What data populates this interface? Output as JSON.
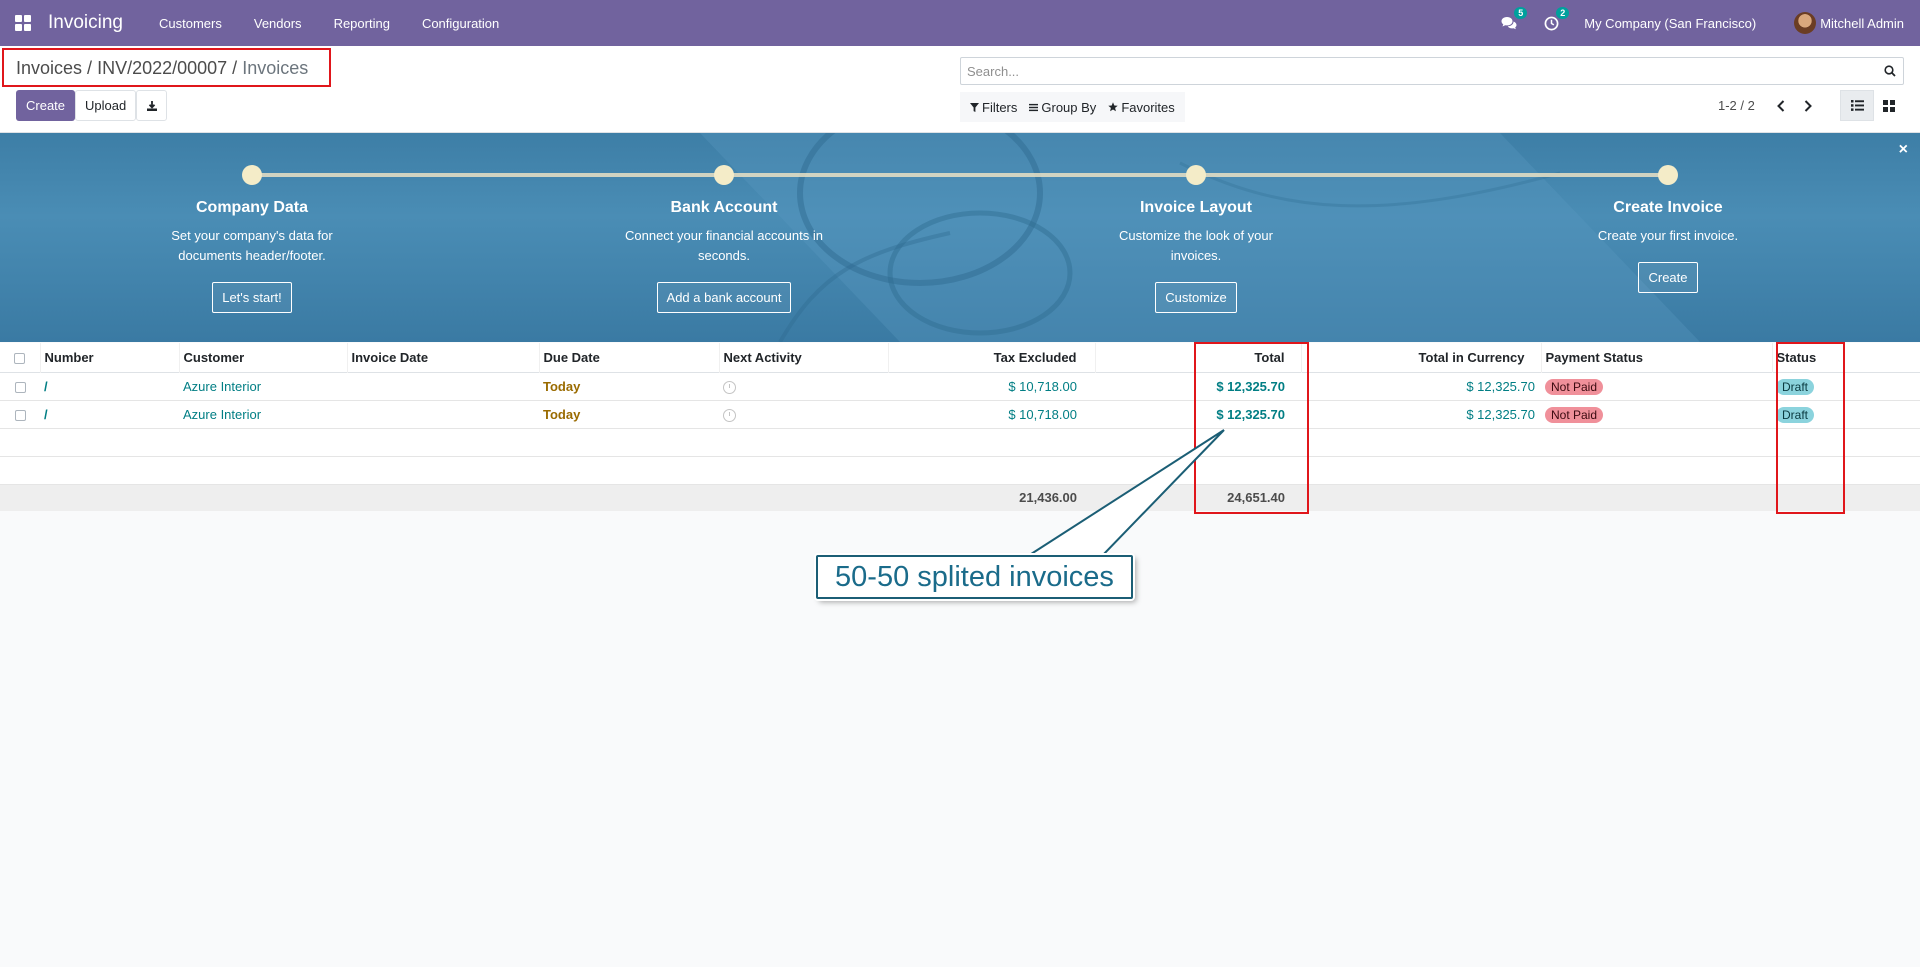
{
  "navbar": {
    "brand": "Invoicing",
    "menus": [
      "Customers",
      "Vendors",
      "Reporting",
      "Configuration"
    ],
    "messages_count": "5",
    "activities_count": "2",
    "company": "My Company (San Francisco)",
    "user": "Mitchell Admin"
  },
  "breadcrumb": {
    "items": [
      "Invoices",
      "INV/2022/00007",
      "Invoices"
    ],
    "separator": "/"
  },
  "actions": {
    "create": "Create",
    "upload": "Upload"
  },
  "search": {
    "placeholder": "Search..."
  },
  "filters": {
    "filters": "Filters",
    "group_by": "Group By",
    "favorites": "Favorites"
  },
  "pager": {
    "value": "1-2 / 2"
  },
  "onboarding": {
    "steps": [
      {
        "title": "Company Data",
        "description": "Set your company's data for documents header/footer.",
        "button": "Let's start!"
      },
      {
        "title": "Bank Account",
        "description": "Connect your financial accounts in seconds.",
        "button": "Add a bank account"
      },
      {
        "title": "Invoice Layout",
        "description": "Customize the look of your invoices.",
        "button": "Customize"
      },
      {
        "title": "Create Invoice",
        "description": "Create your first invoice.",
        "button": "Create"
      }
    ],
    "close": "×"
  },
  "table": {
    "columns": [
      "Number",
      "Customer",
      "Invoice Date",
      "Due Date",
      "Next Activity",
      "Tax Excluded",
      "Total",
      "Total in Currency",
      "Payment Status",
      "Status"
    ],
    "rows": [
      {
        "number": "/",
        "customer": "Azure Interior",
        "invoice_date": "",
        "due_date": "Today",
        "tax_excluded": "$ 10,718.00",
        "total": "$ 12,325.70",
        "total_currency": "$ 12,325.70",
        "payment_status": "Not Paid",
        "status": "Draft"
      },
      {
        "number": "/",
        "customer": "Azure Interior",
        "invoice_date": "",
        "due_date": "Today",
        "tax_excluded": "$ 10,718.00",
        "total": "$ 12,325.70",
        "total_currency": "$ 12,325.70",
        "payment_status": "Not Paid",
        "status": "Draft"
      }
    ],
    "totals": {
      "tax_excluded": "21,436.00",
      "total": "24,651.40"
    }
  },
  "annotation": {
    "text": "50-50 splited invoices"
  },
  "colors": {
    "navbar": "#71639e",
    "highlight": "#e0161b",
    "link": "#017e84"
  }
}
